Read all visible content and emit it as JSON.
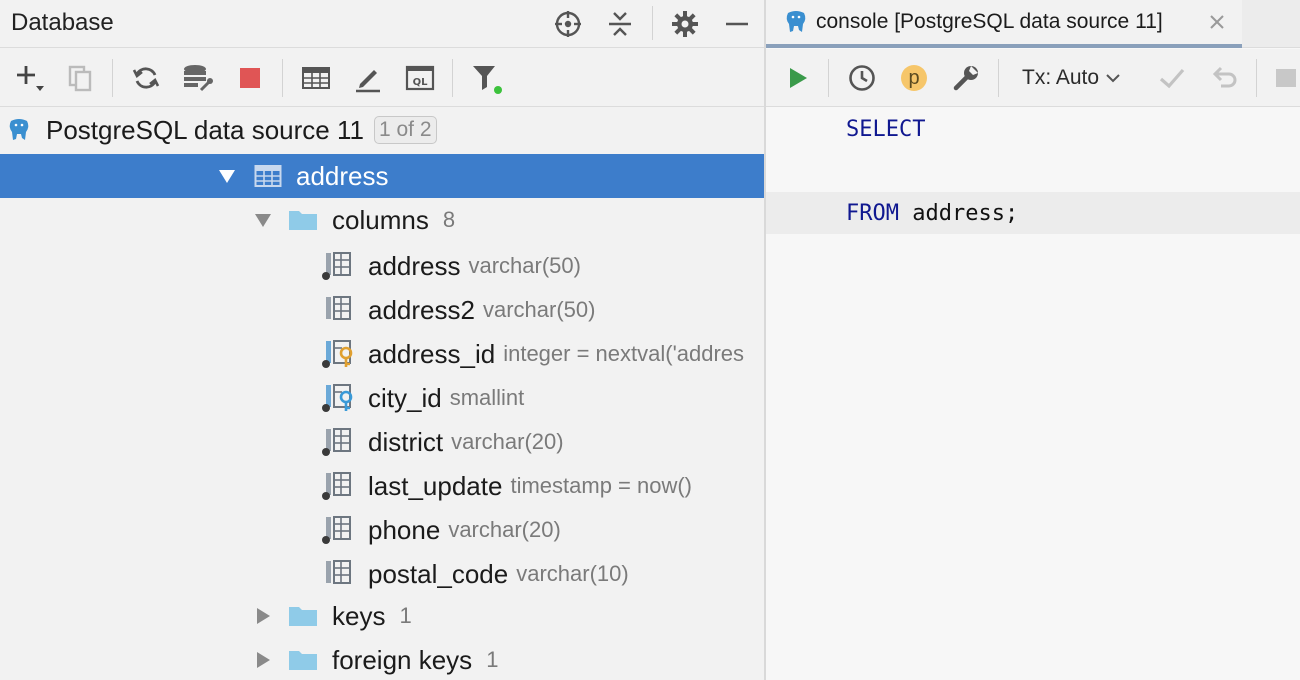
{
  "db_panel": {
    "title": "Database",
    "header_icons": [
      "crosshair-icon",
      "collapse-all-icon",
      "gear-icon",
      "minimize-icon"
    ],
    "toolbar_icons": [
      "add-icon",
      "duplicate-icon",
      "refresh-icon",
      "schema-sync-icon",
      "stop-icon",
      "table-view-icon",
      "edit-icon",
      "query-console-icon",
      "filter-icon"
    ]
  },
  "tree": {
    "datasource": {
      "label": "PostgreSQL data source 11",
      "badge": "1 of 2"
    },
    "table": {
      "label": "address"
    },
    "columns_folder": {
      "label": "columns",
      "count": "8"
    },
    "columns": [
      {
        "name": "address",
        "type": "varchar(50)",
        "icon": "column-icon"
      },
      {
        "name": "address2",
        "type": "varchar(50)",
        "icon": "column-icon"
      },
      {
        "name": "address_id",
        "type": "integer = nextval('addres",
        "icon": "primary-key-column-icon"
      },
      {
        "name": "city_id",
        "type": "smallint",
        "icon": "foreign-key-column-icon"
      },
      {
        "name": "district",
        "type": "varchar(20)",
        "icon": "column-icon"
      },
      {
        "name": "last_update",
        "type": "timestamp = now()",
        "icon": "column-icon"
      },
      {
        "name": "phone",
        "type": "varchar(20)",
        "icon": "column-icon"
      },
      {
        "name": "postal_code",
        "type": "varchar(10)",
        "icon": "column-icon"
      }
    ],
    "keys_folder": {
      "label": "keys",
      "count": "1"
    },
    "foreign_keys_folder": {
      "label": "foreign keys",
      "count": "1"
    }
  },
  "console": {
    "tab_title": "console [PostgreSQL data source 11]",
    "tx_mode": "Tx: Auto",
    "param_badge": "p",
    "code": {
      "line1": "SELECT",
      "line3_keyword": "FROM",
      "line3_rest": " address;"
    }
  },
  "colors": {
    "selection": "#3d7dcb",
    "run_green": "#3a9a4a",
    "stop_red": "#e05555",
    "folder_blue": "#8fcbe8",
    "key_orange": "#e0a030",
    "keyword_blue": "#101890"
  }
}
